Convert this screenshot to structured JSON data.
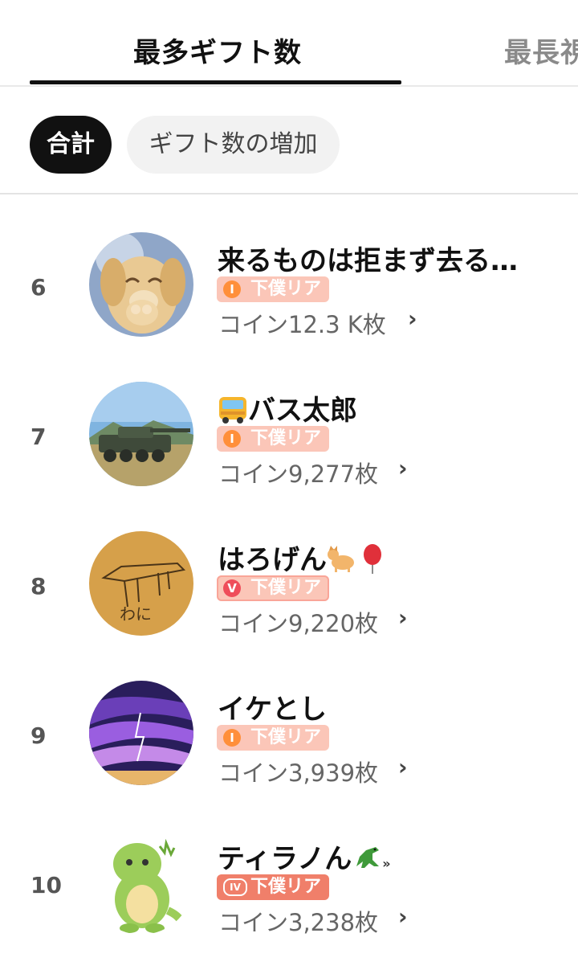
{
  "tabs": {
    "active": "最多ギフト数",
    "inactive": "最長視"
  },
  "filters": {
    "selected": "合計",
    "other": "ギフト数の増加"
  },
  "rows": [
    {
      "rank": "6",
      "name": "来るものは拒まず去る…",
      "badge": "下僕リア",
      "badge_icon": "I",
      "coins": "コイン12.3 K枚",
      "chevron": "›",
      "avatar_icon": "puppy-avatar"
    },
    {
      "rank": "7",
      "name": "バス太郎",
      "badge": "下僕リア",
      "badge_icon": "I",
      "coins": "コイン9,277枚",
      "chevron": "›",
      "avatar_icon": "tank-avatar"
    },
    {
      "rank": "8",
      "name": "はろげん",
      "badge": "下僕リア",
      "badge_icon": "V",
      "coins": "コイン9,220枚",
      "chevron": "›",
      "avatar_icon": "crocodile-drawing-avatar",
      "avatar_text": "わに"
    },
    {
      "rank": "9",
      "name": "イケとし",
      "badge": "下僕リア",
      "badge_icon": "I",
      "coins": "コイン3,939枚",
      "chevron": "›",
      "avatar_icon": "storm-sky-avatar"
    },
    {
      "rank": "10",
      "name": "ティラノん",
      "badge": "下僕リア",
      "badge_icon": "IV",
      "coins": "コイン3,238枚",
      "chevron": "›",
      "avatar_icon": "dinosaur-avatar"
    }
  ],
  "colors": {
    "badge_bg": "#fbc6b8",
    "badge_level_iv": "#f07f6a",
    "selected_chip": "#111111",
    "tab_underline": "#111111"
  }
}
